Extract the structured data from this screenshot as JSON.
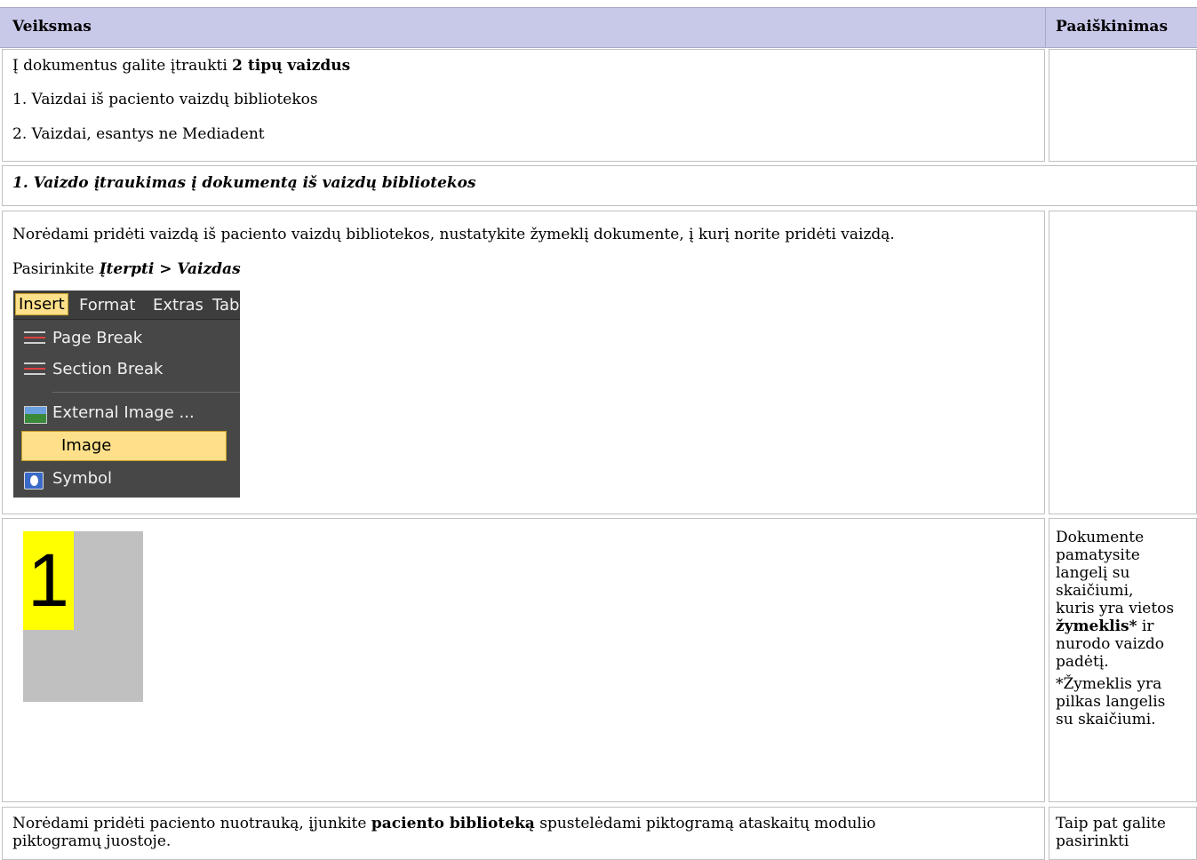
{
  "table": {
    "col1_header": "Veiksmas",
    "col2_header": "Paaiškinimas"
  },
  "row1": {
    "line1_plain": "Į dokumentus galite įtraukti ",
    "line1_bold": "2 tipų vaizdus",
    "line2": "1. Vaizdai iš paciento vaizdų bibliotekos",
    "line3": "2. Vaizdai, esantys ne Mediadent"
  },
  "section1": {
    "heading": "1. Vaizdo įtraukimas į dokumentą iš vaizdų bibliotekos"
  },
  "row3": {
    "line1": "Norėdami pridėti vaizdą iš paciento vaizdų bibliotekos, nustatykite žymeklį dokumente, į kurį norite pridėti vaizdą.",
    "line2_plain": "Pasirinkite ",
    "line2_italic1": "Įterpti",
    "line2_sep": " > ",
    "line2_italic2": "Vaizdas"
  },
  "menu": {
    "bar": [
      "Insert",
      "Format",
      "Extras",
      "Tab"
    ],
    "items": [
      "Page Break",
      "Section Break",
      "External Image ...",
      "Image",
      "Symbol"
    ],
    "highlight_color": "#ffe08a"
  },
  "row4": {
    "marker_number": "1",
    "marker_color": "#ffff00",
    "explain_lines": [
      "Dokumente",
      "pamatysite",
      "langelį su",
      "skaičiumi,",
      "kuris yra vietos"
    ],
    "explain_bold": "žymeklis*",
    "explain_after_bold": " ir",
    "explain_lines2": [
      "nurodo vaizdo",
      "padėtį."
    ],
    "note_lines": [
      "*Žymeklis yra",
      "pilkas langelis",
      "su skaičiumi."
    ]
  },
  "row5": {
    "line1_plain": "Norėdami pridėti paciento nuotrauką, įjunkite ",
    "line1_bold": "paciento biblioteką",
    "line1_rest": " spustelėdami piktogramą ataskaitų modulio",
    "line2": "piktogramų juostoje.",
    "explain_lines": [
      "Taip pat galite",
      "pasirinkti"
    ]
  }
}
